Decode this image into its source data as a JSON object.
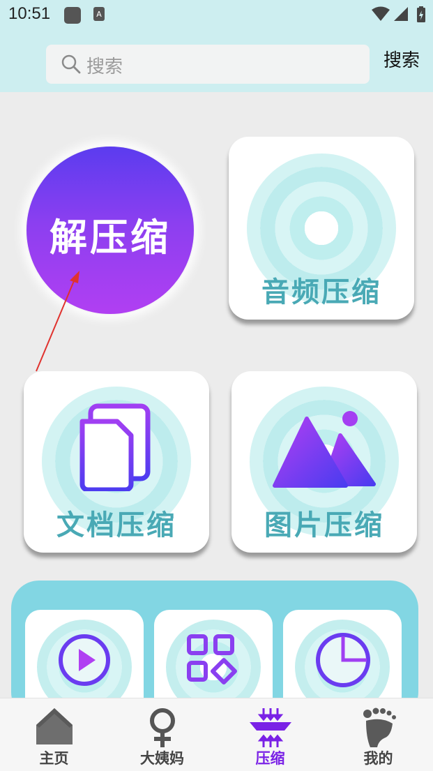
{
  "status_bar": {
    "time": "10:51"
  },
  "search": {
    "placeholder": "搜索",
    "action_label": "搜索"
  },
  "features": {
    "decompress": "解压缩",
    "audio": "音频压缩",
    "document": "文档压缩",
    "image": "图片压缩"
  },
  "tools": [
    {
      "icon": "play-icon"
    },
    {
      "icon": "grid-icon"
    },
    {
      "icon": "pie-chart-icon"
    }
  ],
  "bottom_nav": [
    {
      "label": "主页",
      "icon": "home-icon"
    },
    {
      "label": "大姨妈",
      "icon": "female-icon"
    },
    {
      "label": "压缩",
      "icon": "compress-icon",
      "active": true
    },
    {
      "label": "我的",
      "icon": "footprint-icon"
    }
  ],
  "colors": {
    "accent": "#7a22e6",
    "label_teal": "#49a9b5",
    "header_bg": "#cdeef0",
    "panel_bg": "#82d6e3"
  }
}
